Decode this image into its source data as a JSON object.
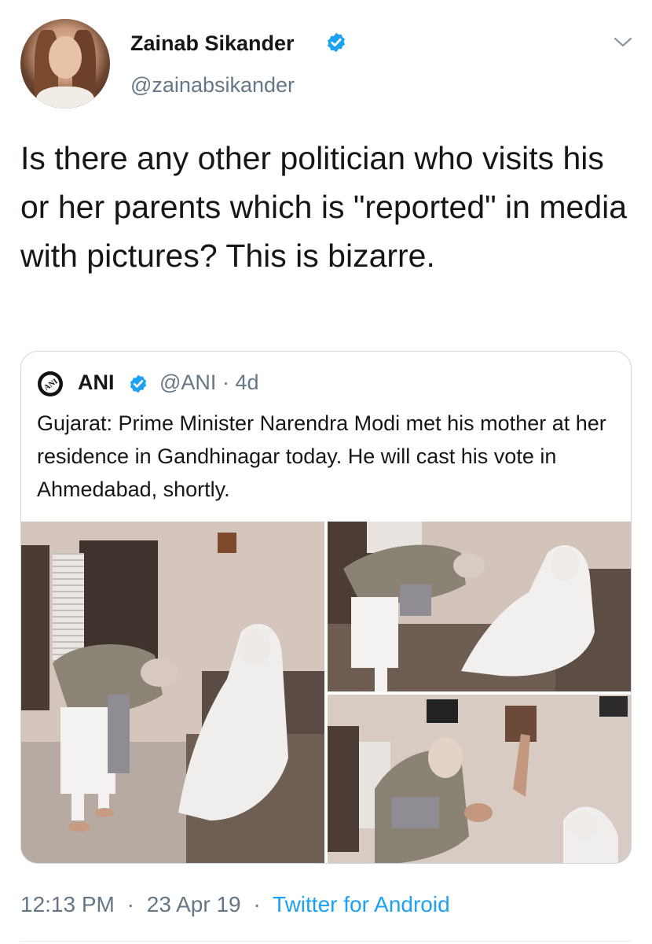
{
  "tweet": {
    "author_name": "Zainab Sikander",
    "handle": "@zainabsikander",
    "text": "Is there any other politician who visits his or her parents which is \"reported\" in media with pictures? This is bizarre.",
    "time": "12:13 PM",
    "date": "23 Apr 19",
    "source": "Twitter for Android",
    "separator": "·"
  },
  "quote": {
    "author_name": "ANI",
    "handle": "@ANI",
    "age": "4d",
    "separator": "·",
    "logo_text": "ANI",
    "text": "Gujarat: Prime Minister Narendra Modi met his mother at her residence in Gandhinagar today. He will cast his vote in Ahmedabad, shortly."
  },
  "icons": {
    "verified": "verified-badge-icon",
    "caret": "chevron-down-icon"
  },
  "colors": {
    "accent": "#1da1f2",
    "secondary_text": "#657786",
    "border": "#ccd6dd"
  }
}
